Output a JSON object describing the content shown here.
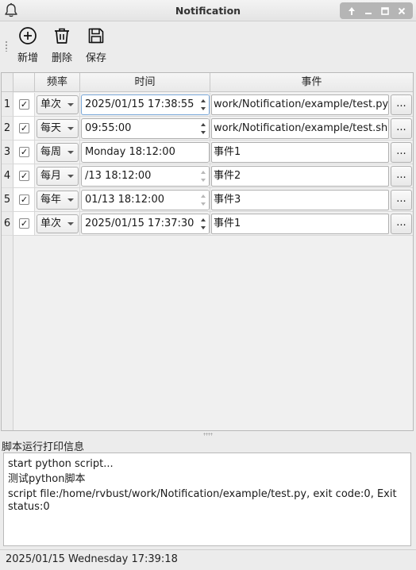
{
  "window": {
    "title": "Notification",
    "icon": "bell-icon",
    "buttons": [
      "pin-icon",
      "minimize-icon",
      "maximize-icon",
      "close-icon"
    ]
  },
  "toolbar": {
    "add_label": "新增",
    "delete_label": "删除",
    "save_label": "保存"
  },
  "table": {
    "headers": [
      "",
      "频率",
      "时间",
      "事件"
    ],
    "rows": [
      {
        "num": "1",
        "checked": "✓",
        "freq": "单次",
        "time": "2025/01/15 17:38:55",
        "event": "work/Notification/example/test.py",
        "more": "..."
      },
      {
        "num": "2",
        "checked": "✓",
        "freq": "每天",
        "time": "09:55:00",
        "event": "work/Notification/example/test.sh",
        "more": "..."
      },
      {
        "num": "3",
        "checked": "✓",
        "freq": "每周",
        "time": "Monday 18:12:00",
        "event": "事件1",
        "more": "..."
      },
      {
        "num": "4",
        "checked": "✓",
        "freq": "每月",
        "time": "/13 18:12:00",
        "event": "事件2",
        "more": "..."
      },
      {
        "num": "5",
        "checked": "✓",
        "freq": "每年",
        "time": "01/13 18:12:00",
        "event": "事件3",
        "more": "..."
      },
      {
        "num": "6",
        "checked": "✓",
        "freq": "单次",
        "time": "2025/01/15 17:37:30",
        "event": "事件1",
        "more": "..."
      }
    ]
  },
  "log": {
    "label": "脚本运行打印信息",
    "lines": [
      "start python script...",
      "测试python脚本",
      "script file:/home/rvbust/work/Notification/example/test.py, exit code:0, Exit status:0"
    ]
  },
  "status": {
    "text": "2025/01/15 Wednesday 17:39:18"
  }
}
